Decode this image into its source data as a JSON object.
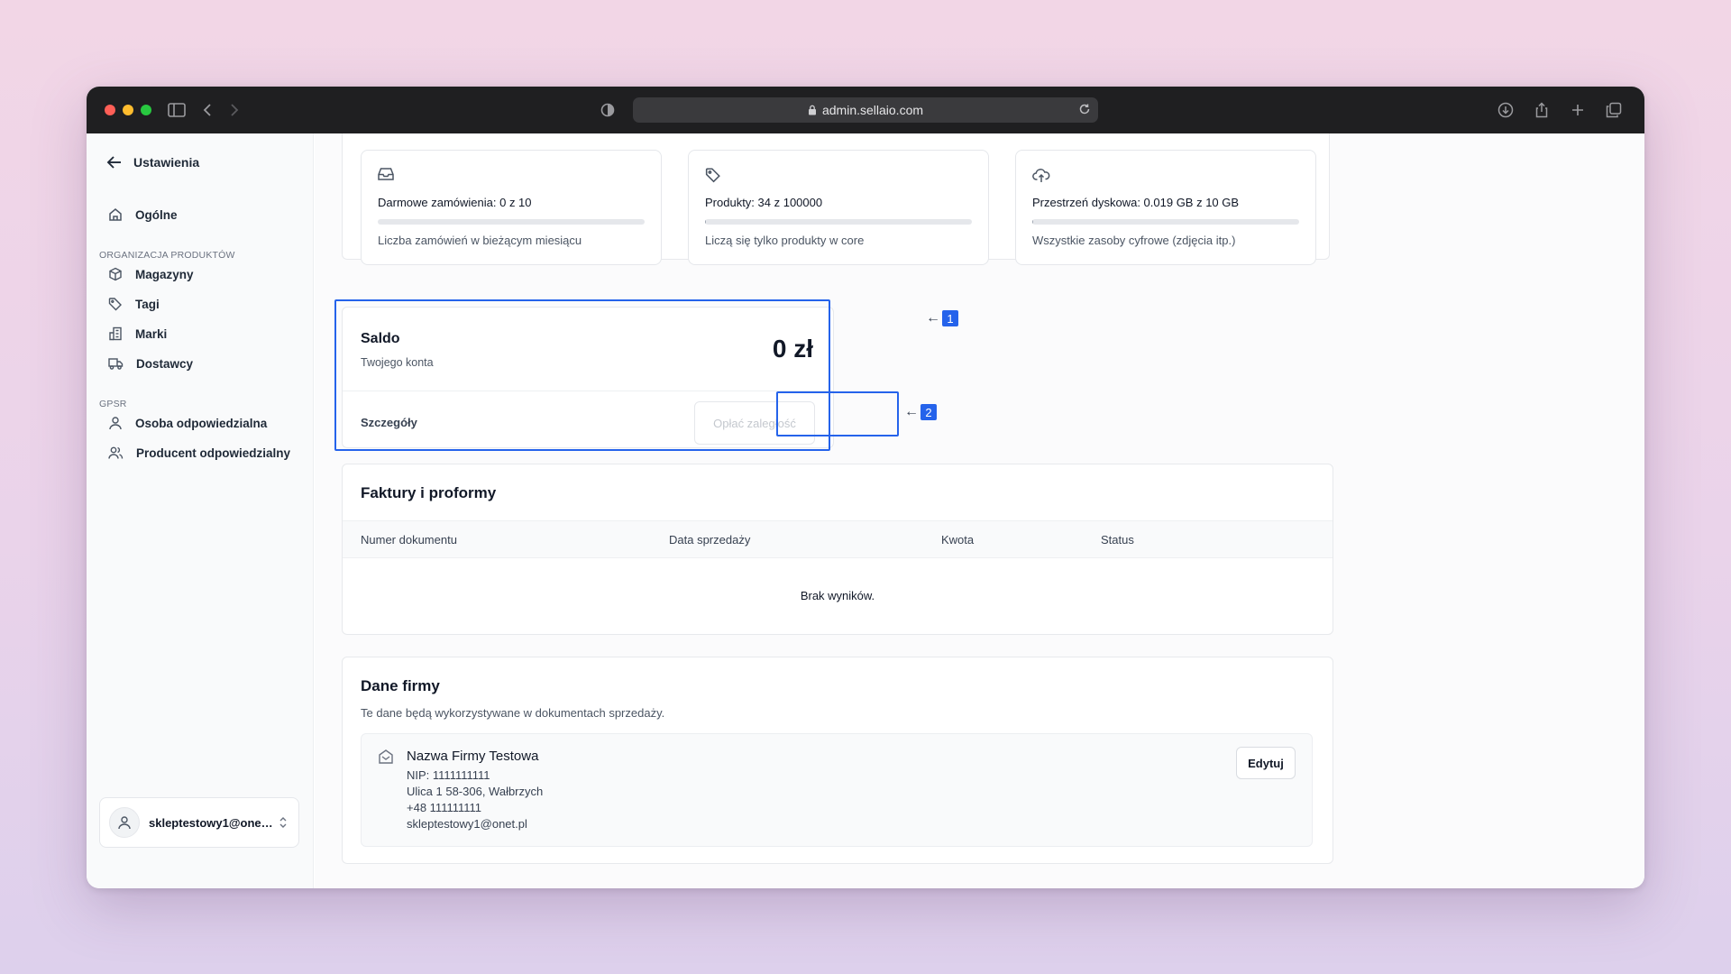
{
  "browser": {
    "url": "admin.sellaio.com"
  },
  "sidebar": {
    "back_label": "Ustawienia",
    "general": "Ogólne",
    "section_products": "ORGANIZACJA PRODUKTÓW",
    "items_products": [
      "Magazyny",
      "Tagi",
      "Marki",
      "Dostawcy"
    ],
    "section_gpsr": "GPSR",
    "items_gpsr": [
      "Osoba odpowiedzialna",
      "Producent odpowiedzialny"
    ],
    "user_email": "skleptestowy1@onet.pl"
  },
  "usage": [
    {
      "icon": "inbox-icon",
      "title": "Darmowe zamówienia: 0 z 10",
      "desc": "Liczba zamówień w bieżącym miesiącu",
      "fraction": 0
    },
    {
      "icon": "tag-icon",
      "title": "Produkty: 34 z 100000",
      "desc": "Liczą się tylko produkty w core",
      "fraction": 0.00034
    },
    {
      "icon": "cloud-upload-icon",
      "title": "Przestrzeń dyskowa: 0.019 GB z 10 GB",
      "desc": "Wszystkie zasoby cyfrowe (zdjęcia itp.)",
      "fraction": 0.0019
    }
  ],
  "saldo": {
    "title": "Saldo",
    "subtitle": "Twojego konta",
    "amount": "0 zł",
    "details": "Szczegóły",
    "pay_button": "Opłać zaległość"
  },
  "annotations": {
    "marker1": "1",
    "marker2": "2",
    "accent": "#2563eb"
  },
  "invoices": {
    "title": "Faktury i proformy",
    "columns": [
      "Numer dokumentu",
      "Data sprzedaży",
      "Kwota",
      "Status"
    ],
    "empty": "Brak wyników."
  },
  "company": {
    "title": "Dane firmy",
    "subtitle": "Te dane będą wykorzystywane w dokumentach sprzedaży.",
    "name": "Nazwa Firmy Testowa",
    "nip": "NIP: 1111111111",
    "address": "Ulica 1 58-306, Wałbrzych",
    "phone": "+48 111111111",
    "email": "skleptestowy1@onet.pl",
    "edit_button": "Edytuj"
  }
}
